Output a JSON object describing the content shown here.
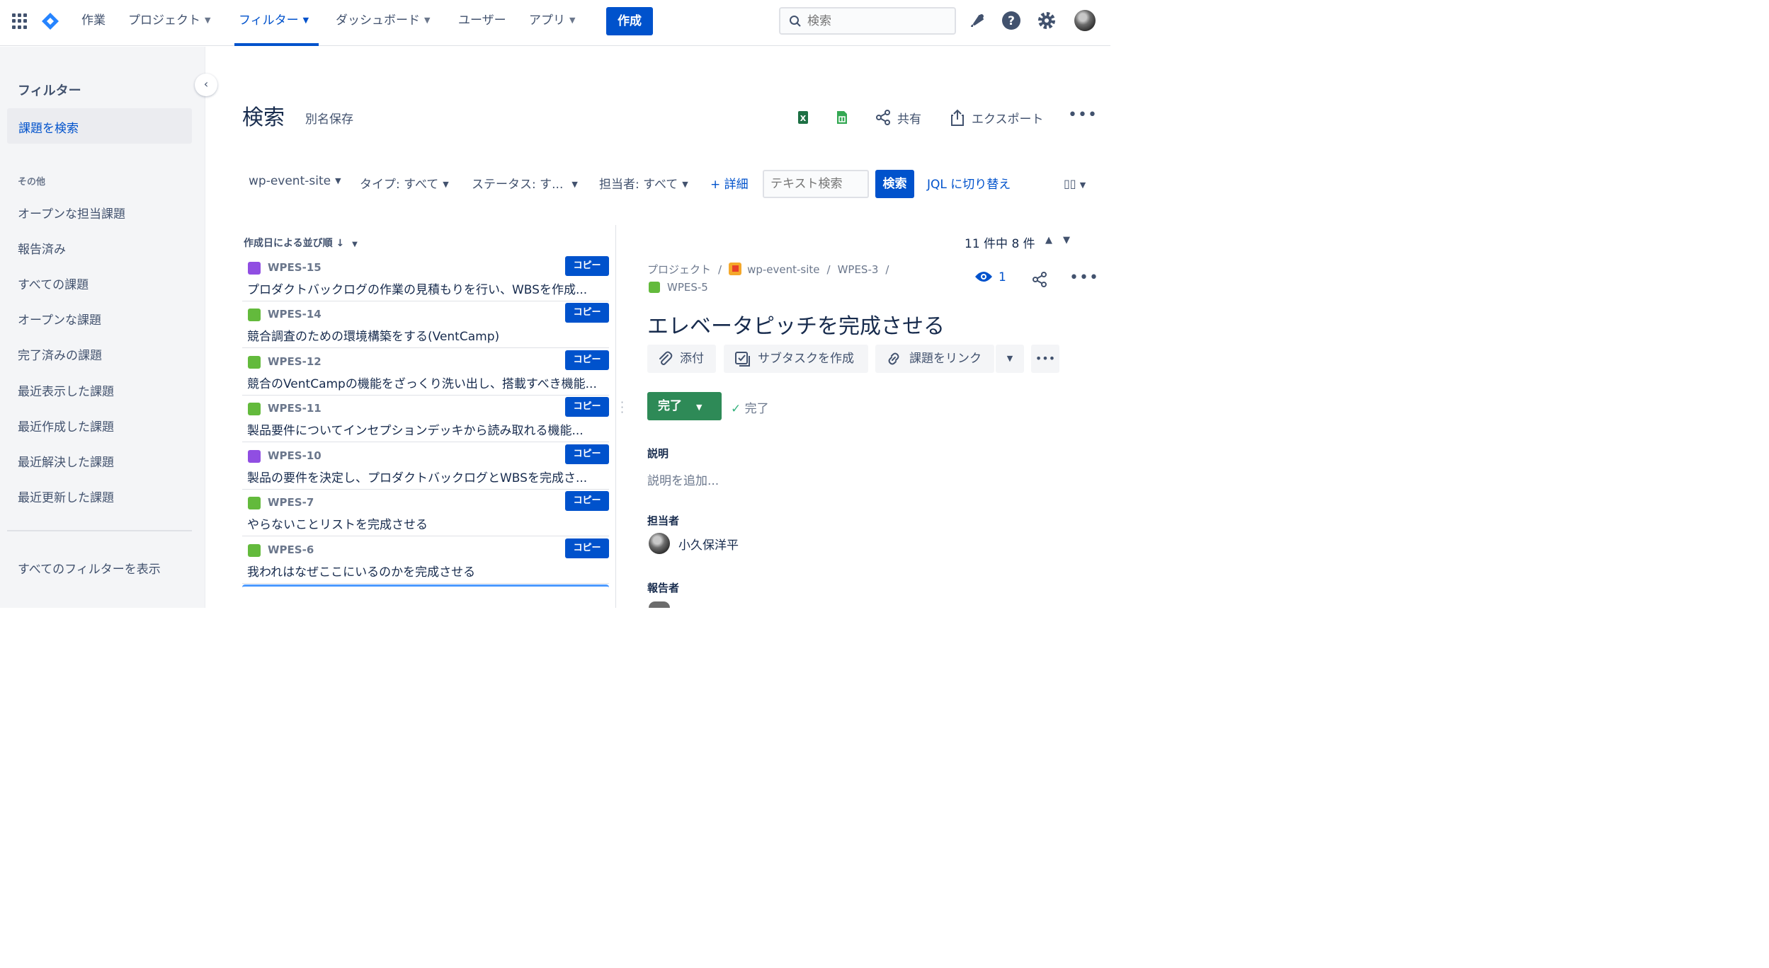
{
  "nav": {
    "items": [
      {
        "label": "作業",
        "has_menu": false
      },
      {
        "label": "プロジェクト",
        "has_menu": true
      },
      {
        "label": "フィルター",
        "has_menu": true,
        "active": true
      },
      {
        "label": "ダッシュボード",
        "has_menu": true
      },
      {
        "label": "ユーザー",
        "has_menu": false
      },
      {
        "label": "アプリ",
        "has_menu": true
      }
    ],
    "create_label": "作成",
    "search_placeholder": "検索",
    "icons": [
      "app-switcher-icon",
      "jira-logo-icon",
      "notifications-icon",
      "help-icon",
      "settings-icon"
    ]
  },
  "sidebar": {
    "title": "フィルター",
    "active_item": "課題を検索",
    "section_label": "その他",
    "links": [
      "オープンな担当課題",
      "報告済み",
      "すべての課題",
      "オープンな課題",
      "完了済みの課題",
      "最近表示した課題",
      "最近作成した課題",
      "最近解決した課題",
      "最近更新した課題"
    ],
    "footer_link": "すべてのフィルターを表示"
  },
  "header": {
    "title": "検索",
    "save_as": "別名保存",
    "share_label": "共有",
    "export_label": "エクスポート"
  },
  "filters": {
    "project": "wp-event-site",
    "type": "タイプ: すべて",
    "status": "ステータス: す...",
    "assignee": "担当者: すべて",
    "more": "+ 詳細",
    "text_placeholder": "テキスト検索",
    "search_button": "検索",
    "jql_link": "JQL に切り替え"
  },
  "list": {
    "sort_label": "作成日による並び順",
    "copy_label": "コピー",
    "issues": [
      {
        "key": "WPES-15",
        "type": "epic",
        "summary": "プロダクトバックログの作業の見積もりを行い、WBSを作成..."
      },
      {
        "key": "WPES-14",
        "type": "story",
        "summary": "競合調査のための環境構築をする(VentCamp)"
      },
      {
        "key": "WPES-12",
        "type": "story",
        "summary": "競合のVentCampの機能をざっくり洗い出し、搭載すべき機能..."
      },
      {
        "key": "WPES-11",
        "type": "story",
        "summary": "製品要件についてインセプションデッキから読み取れる機能..."
      },
      {
        "key": "WPES-10",
        "type": "epic",
        "summary": "製品の要件を決定し、プロダクトバックログとWBSを完成さ..."
      },
      {
        "key": "WPES-7",
        "type": "story",
        "summary": "やらないことリストを完成させる"
      },
      {
        "key": "WPES-6",
        "type": "story",
        "summary": "我われはなぜここにいるのかを完成させる"
      }
    ]
  },
  "detail": {
    "count": "11 件中 8 件",
    "crumb_root": "プロジェクト",
    "crumb_project": "wp-event-site",
    "crumb_parent": "WPES-3",
    "crumb_key": "WPES-5",
    "watchers": "1",
    "title": "エレベータピッチを完成させる",
    "actions": {
      "attach": "添付",
      "subtask": "サブタスクを作成",
      "link": "課題をリンク"
    },
    "status": "完了",
    "resolution": "完了",
    "description_label": "説明",
    "description_placeholder": "説明を追加...",
    "assignee_label": "担当者",
    "assignee": "小久保洋平",
    "reporter_label": "報告者"
  },
  "colors": {
    "primary": "#0052cc",
    "done": "#2e8a57",
    "story": "#63ba3c",
    "epic": "#904ee2"
  }
}
